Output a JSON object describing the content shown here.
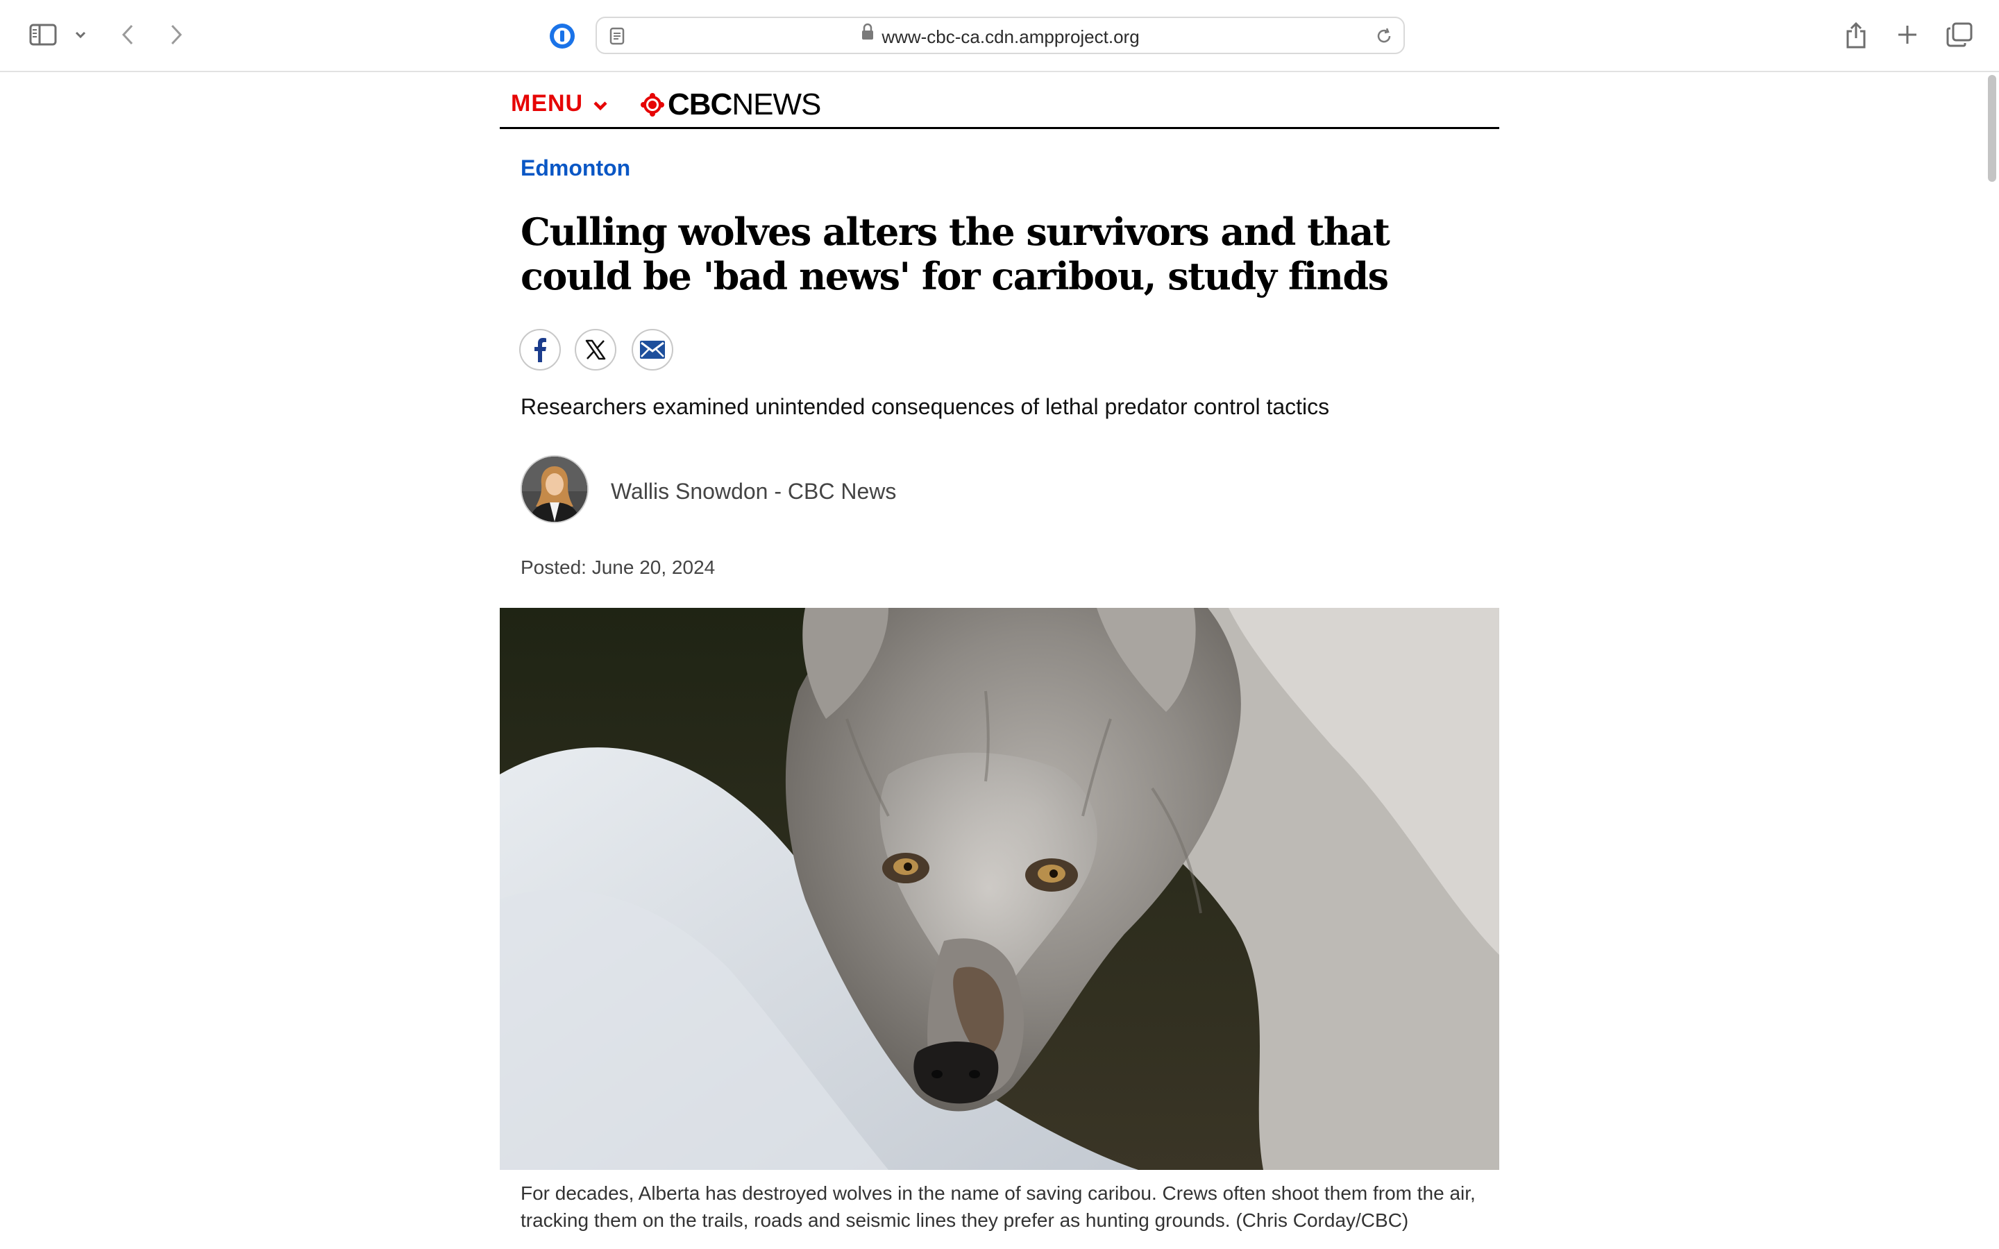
{
  "browser": {
    "url": "www-cbc-ca.cdn.ampproject.org",
    "icons": [
      "sidebar-icon",
      "chevron-down-icon",
      "back-icon",
      "forward-icon",
      "password-manager-icon",
      "reader-icon",
      "lock-icon",
      "reload-icon",
      "share-icon",
      "new-tab-icon",
      "tabs-overview-icon"
    ]
  },
  "masthead": {
    "menu_label": "MENU",
    "logo_cbc": "CBC",
    "logo_news": "NEWS",
    "accent": "#e60505"
  },
  "article": {
    "section": "Edmonton",
    "section_color": "#0a57c5",
    "headline": "Culling wolves alters the survivors and that could be 'bad news' for caribou, study finds",
    "share_icons": [
      "facebook-icon",
      "x-icon",
      "email-icon"
    ],
    "deck": "Researchers examined unintended consequences of lethal predator control tactics",
    "byline": "Wallis Snowdon - CBC News",
    "posted": "Posted: June 20, 2024",
    "caption": "For decades, Alberta has destroyed wolves in the name of saving caribou. Crews often shoot them from the air, tracking them on the trails, roads and seismic lines they prefer as hunting grounds. (Chris Corday/CBC)"
  }
}
